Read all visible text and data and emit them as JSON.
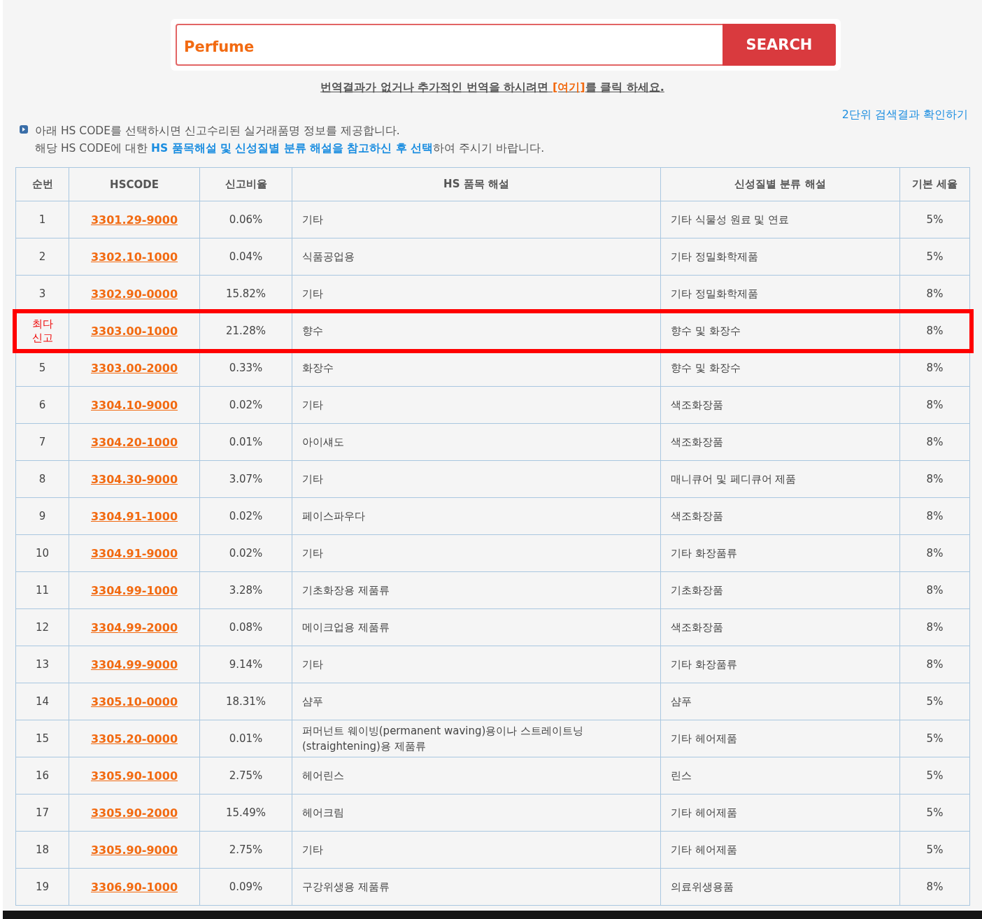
{
  "search": {
    "value": "Perfume",
    "button": "SEARCH"
  },
  "translate_note": {
    "before": "번역결과가 없거나 추가적인 번역을 하시려면 ",
    "link": "[여기]",
    "after": "를 클릭 하세요."
  },
  "level2_link": "2단위 검색결과 확인하기",
  "notice": [
    [
      {
        "text": "아래 HS CODE를 선택하시면 신고수리된 실거래품명 정보를 제공합니다.",
        "highlight": false
      }
    ],
    [
      {
        "text": "해당 HS CODE에 대한 ",
        "highlight": false
      },
      {
        "text": "HS 품목해설 및 신성질별 분류 해설을 참고하신 후 선택",
        "highlight": true
      },
      {
        "text": "하여 주시기 바랍니다.",
        "highlight": false
      }
    ]
  ],
  "table": {
    "columns": [
      "순번",
      "HSCODE",
      "신고비율",
      "HS 품목 해설",
      "신성질별 분류 해설",
      "기본 세율"
    ],
    "rows": [
      {
        "no": "1",
        "code": "3301.29-9000",
        "ratio": "0.06%",
        "hs_desc": "기타",
        "class_desc": "기타 식물성 원료 및 연료",
        "tax": "5%",
        "highlighted": false
      },
      {
        "no": "2",
        "code": "3302.10-1000",
        "ratio": "0.04%",
        "hs_desc": "식품공업용",
        "class_desc": "기타 정밀화학제품",
        "tax": "5%",
        "highlighted": false
      },
      {
        "no": "3",
        "code": "3302.90-0000",
        "ratio": "15.82%",
        "hs_desc": "기타",
        "class_desc": "기타 정밀화학제품",
        "tax": "8%",
        "highlighted": false
      },
      {
        "no": "최다 신고",
        "code": "3303.00-1000",
        "ratio": "21.28%",
        "hs_desc": "향수",
        "class_desc": "향수 및 화장수",
        "tax": "8%",
        "highlighted": true
      },
      {
        "no": "5",
        "code": "3303.00-2000",
        "ratio": "0.33%",
        "hs_desc": "화장수",
        "class_desc": "향수 및 화장수",
        "tax": "8%",
        "highlighted": false
      },
      {
        "no": "6",
        "code": "3304.10-9000",
        "ratio": "0.02%",
        "hs_desc": "기타",
        "class_desc": "색조화장품",
        "tax": "8%",
        "highlighted": false
      },
      {
        "no": "7",
        "code": "3304.20-1000",
        "ratio": "0.01%",
        "hs_desc": "아이섀도",
        "class_desc": "색조화장품",
        "tax": "8%",
        "highlighted": false
      },
      {
        "no": "8",
        "code": "3304.30-9000",
        "ratio": "3.07%",
        "hs_desc": "기타",
        "class_desc": "매니큐어 및 페디큐어 제품",
        "tax": "8%",
        "highlighted": false
      },
      {
        "no": "9",
        "code": "3304.91-1000",
        "ratio": "0.02%",
        "hs_desc": "페이스파우다",
        "class_desc": "색조화장품",
        "tax": "8%",
        "highlighted": false
      },
      {
        "no": "10",
        "code": "3304.91-9000",
        "ratio": "0.02%",
        "hs_desc": "기타",
        "class_desc": "기타 화장품류",
        "tax": "8%",
        "highlighted": false
      },
      {
        "no": "11",
        "code": "3304.99-1000",
        "ratio": "3.28%",
        "hs_desc": "기초화장용 제품류",
        "class_desc": "기초화장품",
        "tax": "8%",
        "highlighted": false
      },
      {
        "no": "12",
        "code": "3304.99-2000",
        "ratio": "0.08%",
        "hs_desc": "메이크업용 제품류",
        "class_desc": "색조화장품",
        "tax": "8%",
        "highlighted": false
      },
      {
        "no": "13",
        "code": "3304.99-9000",
        "ratio": "9.14%",
        "hs_desc": "기타",
        "class_desc": "기타 화장품류",
        "tax": "8%",
        "highlighted": false
      },
      {
        "no": "14",
        "code": "3305.10-0000",
        "ratio": "18.31%",
        "hs_desc": "샴푸",
        "class_desc": "샴푸",
        "tax": "5%",
        "highlighted": false
      },
      {
        "no": "15",
        "code": "3305.20-0000",
        "ratio": "0.01%",
        "hs_desc": "퍼머넌트 웨이빙(permanent waving)용이나 스트레이트닝(straightening)용 제품류",
        "class_desc": "기타 헤어제품",
        "tax": "5%",
        "highlighted": false
      },
      {
        "no": "16",
        "code": "3305.90-1000",
        "ratio": "2.75%",
        "hs_desc": "헤어린스",
        "class_desc": "린스",
        "tax": "5%",
        "highlighted": false
      },
      {
        "no": "17",
        "code": "3305.90-2000",
        "ratio": "15.49%",
        "hs_desc": "헤어크림",
        "class_desc": "기타 헤어제품",
        "tax": "5%",
        "highlighted": false
      },
      {
        "no": "18",
        "code": "3305.90-9000",
        "ratio": "2.75%",
        "hs_desc": "기타",
        "class_desc": "기타 헤어제품",
        "tax": "5%",
        "highlighted": false
      },
      {
        "no": "19",
        "code": "3306.90-1000",
        "ratio": "0.09%",
        "hs_desc": "구강위생용 제품류",
        "class_desc": "의료위생용품",
        "tax": "8%",
        "highlighted": false
      }
    ]
  }
}
